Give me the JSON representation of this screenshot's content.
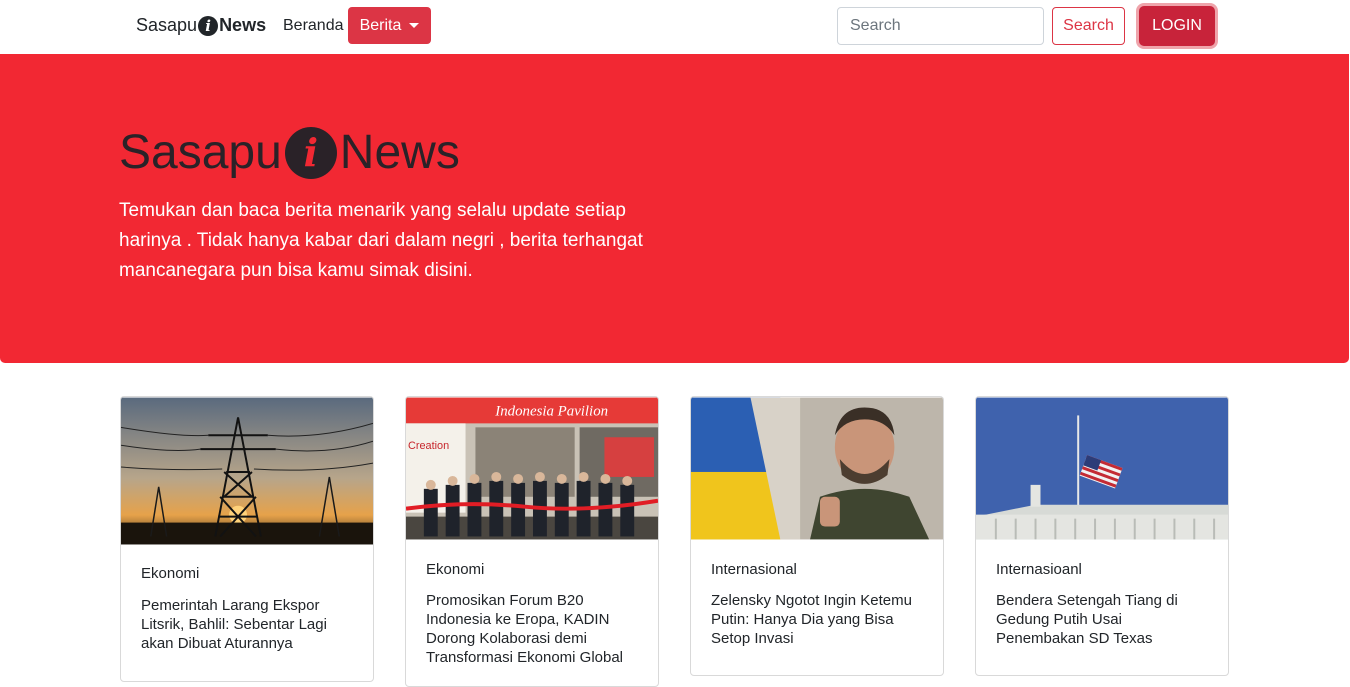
{
  "navbar": {
    "brand_left": "Sasapu",
    "brand_icon": "i",
    "brand_right": "News",
    "home_link": "Beranda",
    "dropdown_label": "Berita",
    "search_placeholder": "Search",
    "search_button": "Search",
    "login_button": "LOGIN"
  },
  "hero": {
    "title_left": "Sasapu",
    "title_icon": "i",
    "title_right": "News",
    "lead": "Temukan dan baca berita menarik yang selalu update setiap harinya . Tidak hanya kabar dari dalam negri , berita terhangat mancanegara pun bisa kamu simak disini.",
    "background_color": "#f22833"
  },
  "cards": [
    {
      "image": "power-tower-sunset-image",
      "category": "Ekonomi",
      "title": "Pemerintah Larang Ekspor Litsrik, Bahlil: Sebentar Lagi akan Dibuat Aturannya"
    },
    {
      "image": "indonesia-pavilion-ribbon-image",
      "category": "Ekonomi",
      "title": "Promosikan Forum B20 Indonesia ke Eropa, KADIN Dorong Kolaborasi demi Transformasi Ekonomi Global",
      "image_sign_1": "Indonesia Pavilion",
      "image_sign_2": "Creation"
    },
    {
      "image": "zelensky-flag-image",
      "category": "Internasional",
      "title": "Zelensky Ngotot Ingin Ketemu Putin: Hanya Dia yang Bisa Setop Invasi"
    },
    {
      "image": "white-house-flag-image",
      "category": "Internasioanl",
      "title": "Bendera Setengah Tiang di Gedung Putih Usai Penembakan SD Texas"
    }
  ],
  "colors": {
    "accent": "#dc3545",
    "dark": "#212529"
  }
}
